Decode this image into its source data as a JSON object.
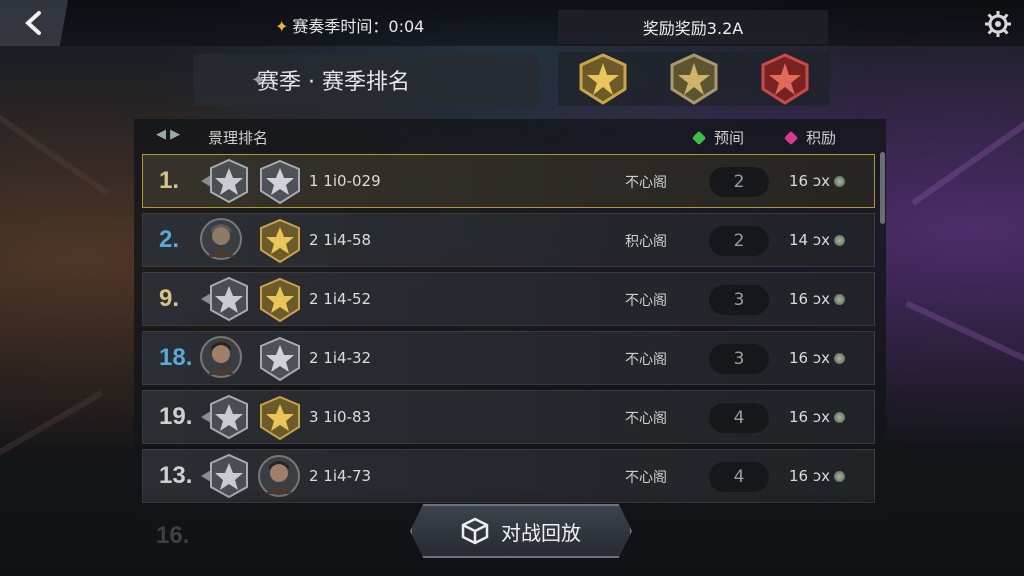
{
  "header": {
    "season_timer": "赛奏季时间：0:04",
    "reward_text": "奖励奖励3.2A"
  },
  "title": "赛季 · 赛季排名",
  "badges": [
    "gold-star-badge",
    "gold-star-badge",
    "red-star-badge"
  ],
  "list_header": {
    "title": "景理排名",
    "col1": "预间",
    "col2": "积励",
    "col1_color": "#3fbf4a",
    "col2_color": "#d63c8c"
  },
  "rows": [
    {
      "rank": "1.",
      "rank_color": "#d8c48a",
      "score": "1 1i0-029",
      "status": "不心阁",
      "count": "2",
      "reward": "16 ɔx",
      "avatar": "silver-emblem",
      "badge": "silver-star-badge",
      "highlight": true
    },
    {
      "rank": "2.",
      "rank_color": "#5aa8d8",
      "score": "2 1i4-58",
      "status": "积心阁",
      "count": "2",
      "reward": "14 ɔx",
      "avatar": "knight-avatar",
      "badge": "gold-star-badge",
      "highlight": false
    },
    {
      "rank": "9.",
      "rank_color": "#d8c48a",
      "score": "2 1i4-52",
      "status": "不心阁",
      "count": "3",
      "reward": "16 ɔx",
      "avatar": "silver-emblem",
      "badge": "gold-star-badge",
      "highlight": false
    },
    {
      "rank": "18.",
      "rank_color": "#5aa8d8",
      "score": "2 1i4-32",
      "status": "不心阁",
      "count": "3",
      "reward": "16 ɔx",
      "avatar": "rogue-avatar",
      "badge": "silver-star-badge",
      "highlight": false
    },
    {
      "rank": "19.",
      "rank_color": "#cfcfcf",
      "score": "3 1i0-83",
      "status": "不心阁",
      "count": "4",
      "reward": "16 ɔx",
      "avatar": "silver-emblem",
      "badge": "gold-star-badge",
      "highlight": false
    },
    {
      "rank": "13.",
      "rank_color": "#cfcfcf",
      "score": "2 1i4-73",
      "status": "不心阁",
      "count": "4",
      "reward": "16 ɔx",
      "avatar": "silver-emblem",
      "badge": "portrait-avatar",
      "highlight": false
    }
  ],
  "ghost_rank": "16.",
  "replay_button": "对战回放",
  "colors": {
    "accent_gold": "#b8962e",
    "panel_bg": "#17191d"
  }
}
